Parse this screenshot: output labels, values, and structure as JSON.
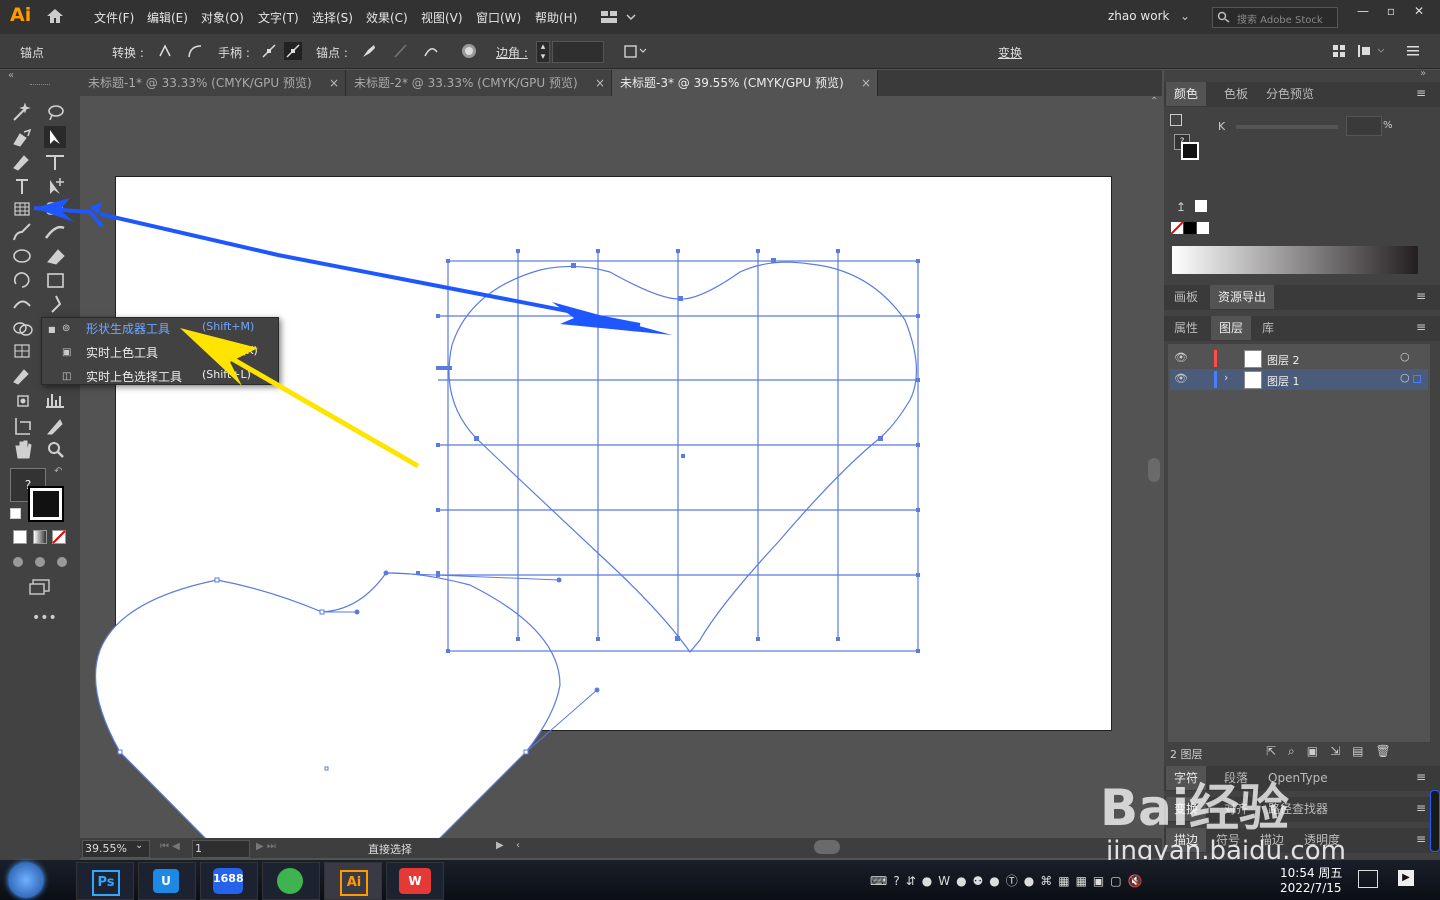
{
  "app": {
    "logo": "Ai",
    "workspace": "zhao work",
    "search_placeholder": "搜索 Adobe Stock"
  },
  "menu": [
    "文件(F)",
    "编辑(E)",
    "对象(O)",
    "文字(T)",
    "选择(S)",
    "效果(C)",
    "视图(V)",
    "窗口(W)",
    "帮助(H)"
  ],
  "control": {
    "anchor": "锚点",
    "convert": "转换 :",
    "handle": "手柄 :",
    "anchor2": "锚点 :",
    "corner": "边角 :",
    "transform": "变换"
  },
  "tabs": [
    {
      "label": "未标题-1* @ 33.33% (CMYK/GPU 预览)"
    },
    {
      "label": "未标题-2* @ 33.33% (CMYK/GPU 预览)"
    },
    {
      "label": "未标题-3* @ 39.55% (CMYK/GPU 预览)"
    }
  ],
  "flyout": [
    {
      "label": "形状生成器工具",
      "shortcut": "(Shift+M)"
    },
    {
      "label": "实时上色工具",
      "shortcut": "(K)"
    },
    {
      "label": "实时上色选择工具",
      "shortcut": "(Shift+L)"
    }
  ],
  "panel": {
    "color_tabs": [
      "颜色",
      "色板",
      "分色预览"
    ],
    "k_label": "K",
    "k_unit": "%",
    "board_tabs": [
      "画板",
      "资源导出"
    ],
    "layer_tabs": [
      "属性",
      "图层",
      "库"
    ],
    "layers": [
      {
        "name": "图层 2",
        "color": "#ff4d4d"
      },
      {
        "name": "图层 1",
        "color": "#4d7dff"
      }
    ],
    "layer_count": "2 图层",
    "char_tabs": [
      "字符",
      "段落",
      "OpenType"
    ],
    "trans_tabs": [
      "变换",
      "对齐",
      "路径查找器"
    ],
    "stroke_tabs": [
      "描边",
      "符号",
      "描边",
      "透明度"
    ]
  },
  "status": {
    "zoom": "39.55%",
    "page": "1",
    "tool": "直接选择"
  },
  "taskbar": {
    "time": "10:54 周五",
    "date": "2022/7/15"
  },
  "watermark": {
    "text": "Bai经验",
    "url": "jingyan.baidu.com"
  },
  "colors": {
    "accent": "#4d7dff",
    "arrow_blue": "#1f57ff",
    "arrow_yellow": "#ffe400",
    "path": "#5b7be0"
  }
}
